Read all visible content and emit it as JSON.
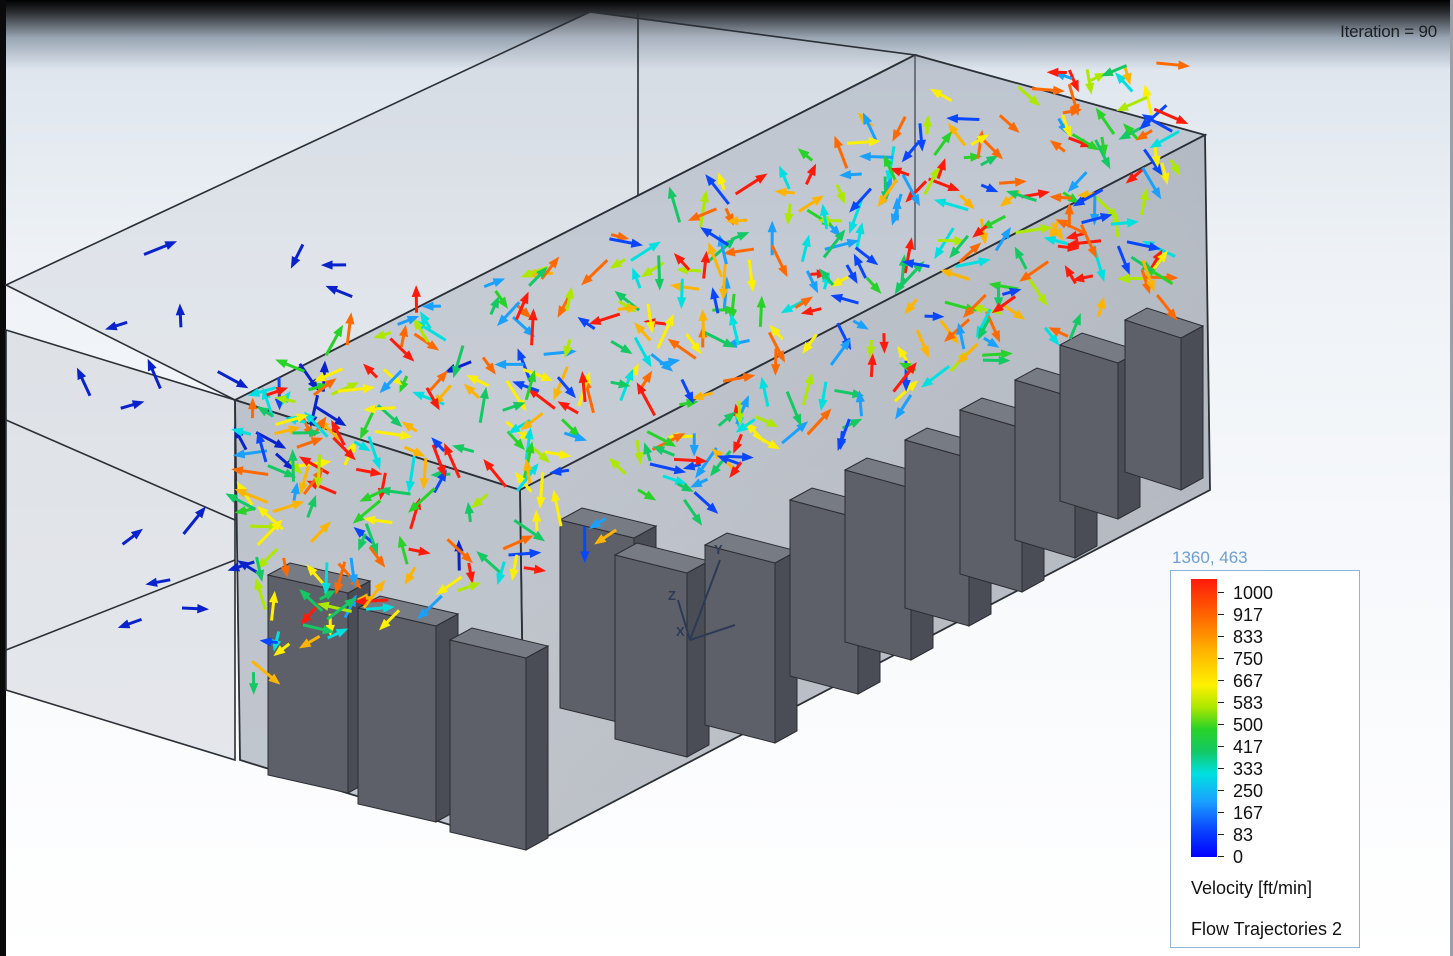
{
  "viewport": {
    "iteration_text": "Iteration = 90",
    "cursor_readout": "1360, 463"
  },
  "triad": {
    "x": "X",
    "y": "Y",
    "z": "Z"
  },
  "legend": {
    "ticks": [
      "1000",
      "917",
      "833",
      "750",
      "667",
      "583",
      "500",
      "417",
      "333",
      "250",
      "167",
      "83",
      "0"
    ],
    "quantity_label": "Velocity [ft/min]",
    "plot_name": "Flow Trajectories 2",
    "colors": [
      "#ff1a0a",
      "#ff6a00",
      "#ffb400",
      "#fff000",
      "#28d228",
      "#00e0e0",
      "#1aa0ff",
      "#0000ff"
    ]
  }
}
